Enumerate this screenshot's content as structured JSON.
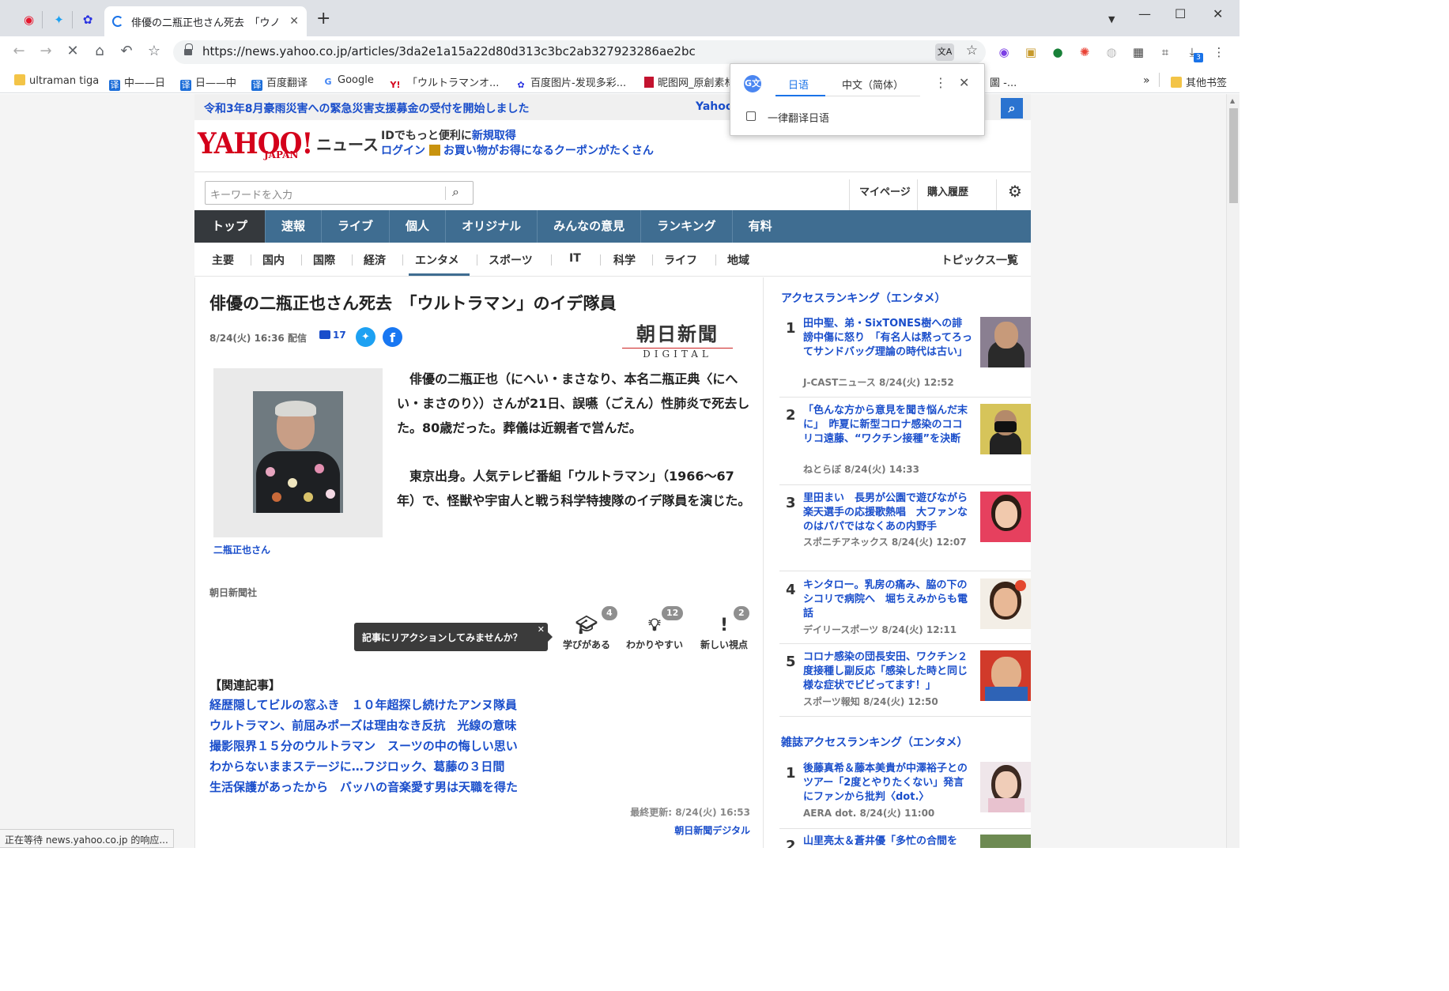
{
  "tabs": {
    "pinned": [
      "weibo",
      "twitter",
      "baidu-paw"
    ],
    "active_title": "俳優の二瓶正也さん死去　「ウノ"
  },
  "toolbar": {
    "url": "https://news.yahoo.co.jp/articles/3da2e1a15a22d80d313c3bc2ab327923286ae2bc",
    "download_badge": "3"
  },
  "bookmarks": [
    {
      "label": "ultraman tiga",
      "icon": "folder"
    },
    {
      "label": "中——日",
      "icon": "译"
    },
    {
      "label": "日——中",
      "icon": "译"
    },
    {
      "label": "百度翻译",
      "icon": "译"
    },
    {
      "label": "Google",
      "icon": "G"
    },
    {
      "label": "「ウルトラマンオ...",
      "icon": "Y!"
    },
    {
      "label": "百度图片-发现多彩...",
      "icon": "paw"
    },
    {
      "label": "昵图网_原創素材",
      "icon": "nipic"
    },
    {
      "label": "圖 -...",
      "icon": ""
    }
  ],
  "bookmarks_more": "»",
  "bookmarks_other": "其他书签",
  "translate_popup": {
    "source_lang": "日语",
    "target_lang": "中文（简体）",
    "always_label": "一律翻译日语"
  },
  "site": {
    "banner": "令和3年8月豪雨災害への緊急災害支援募金の受付を開始しました",
    "banner_right": "Yahoo",
    "logo": "YAHOO!",
    "logo_sub": "JAPAN",
    "logo_news": "ニュース",
    "promo_line1_pre": "IDでもっと便利に",
    "promo_line1_link": "新規取得",
    "promo_login": "ログイン",
    "promo_coupon": "お買い物がお得になるクーポンがたくさん",
    "search_placeholder": "キーワードを入力",
    "mypage": "マイページ",
    "history": "購入履歴",
    "gnav": [
      "トップ",
      "速報",
      "ライブ",
      "個人",
      "オリジナル",
      "みんなの意見",
      "ランキング",
      "有料"
    ],
    "subnav": [
      "主要",
      "国内",
      "国際",
      "経済",
      "エンタメ",
      "スポーツ",
      "IT",
      "科学",
      "ライフ",
      "地域"
    ],
    "subnav_active": "エンタメ",
    "topics": "トピックス一覧"
  },
  "article": {
    "headline": "俳優の二瓶正也さん死去　「ウルトラマン」のイデ隊員",
    "date": "8/24(火) 16:36 配信",
    "comments": "17",
    "publisher_logo_main": "朝日新聞",
    "publisher_logo_sub": "DIGITAL",
    "photo_caption": "二瓶正也さん",
    "para1": "　俳優の二瓶正也（にへい・まさなり、本名二瓶正典〈にへい・まさのり〉）さんが21日、誤嚥（ごえん）性肺炎で死去した。80歳だった。葬儀は近親者で営んだ。",
    "para2": "　東京出身。人気テレビ番組「ウルトラマン」（1966〜67年）で、怪獣や宇宙人と戦う科学特捜隊のイデ隊員を演じた。",
    "source": "朝日新聞社",
    "reaction_prompt": "記事にリアクションしてみませんか？",
    "reactions": [
      {
        "label": "学びがある",
        "count": "4",
        "icon": "mortarboard"
      },
      {
        "label": "わかりやすい",
        "count": "12",
        "icon": "lightbulb"
      },
      {
        "label": "新しい視点",
        "count": "2",
        "icon": "exclamation"
      }
    ],
    "related_heading": "【関連記事】",
    "related": [
      "経歴隠してビルの窓ふき　１０年超探し続けたアンヌ隊員",
      "ウルトラマン、前屈みポーズは理由なき反抗　光線の意味",
      "撮影限界１５分のウルトラマン　スーツの中の悔しい思い",
      "わからないままステージに…フジロック、葛藤の３日間",
      "生活保護があったから　バッハの音楽愛す男は天職を得た"
    ],
    "updated": "最終更新: 8/24(火) 16:53",
    "source_name": "朝日新聞デジタル"
  },
  "ranking": {
    "heading": "アクセスランキング（エンタメ）",
    "items": [
      {
        "rank": "1",
        "title": "田中聖、弟・SixTONES樹への誹謗中傷に怒り　「有名人は黙ってろってサンドバッグ理論の時代は古い」",
        "source": "J-CASTニュース 8/24(火) 12:52"
      },
      {
        "rank": "2",
        "title": "「色んな方から意見を聞き悩んだ末に」　昨夏に新型コロナ感染のココリコ遠藤、“ワクチン接種”を決断",
        "source": "ねとらぼ 8/24(火) 14:33"
      },
      {
        "rank": "3",
        "title": "里田まい　長男が公園で遊びながら楽天選手の応援歌熱唱　大ファンなのはパパではなくあの内野手",
        "source": "スポニチアネックス 8/24(火) 12:07"
      },
      {
        "rank": "4",
        "title": "キンタロー。乳房の痛み、脇の下のシコリで病院へ　堀ちえみからも電話",
        "source": "デイリースポーツ 8/24(火) 12:11"
      },
      {
        "rank": "5",
        "title": "コロナ感染の団長安田、ワクチン２度接種し副反応「感染した時と同じ様な症状でビビってます！」",
        "source": "スポーツ報知 8/24(火) 12:50"
      }
    ],
    "mag_heading": "雑誌アクセスランキング（エンタメ）",
    "mag_items": [
      {
        "rank": "1",
        "title": "後藤真希＆藤本美貴が中澤裕子とのツアー「2度とやりたくない」発言にファンから批判〈dot.〉",
        "source": "AERA dot. 8/24(火) 11:00"
      },
      {
        "rank": "2",
        "title": "山里亮太＆蒼井優「多忙の合間を",
        "source": ""
      }
    ]
  },
  "status_bar": "正在等待 news.yahoo.co.jp 的响应..."
}
